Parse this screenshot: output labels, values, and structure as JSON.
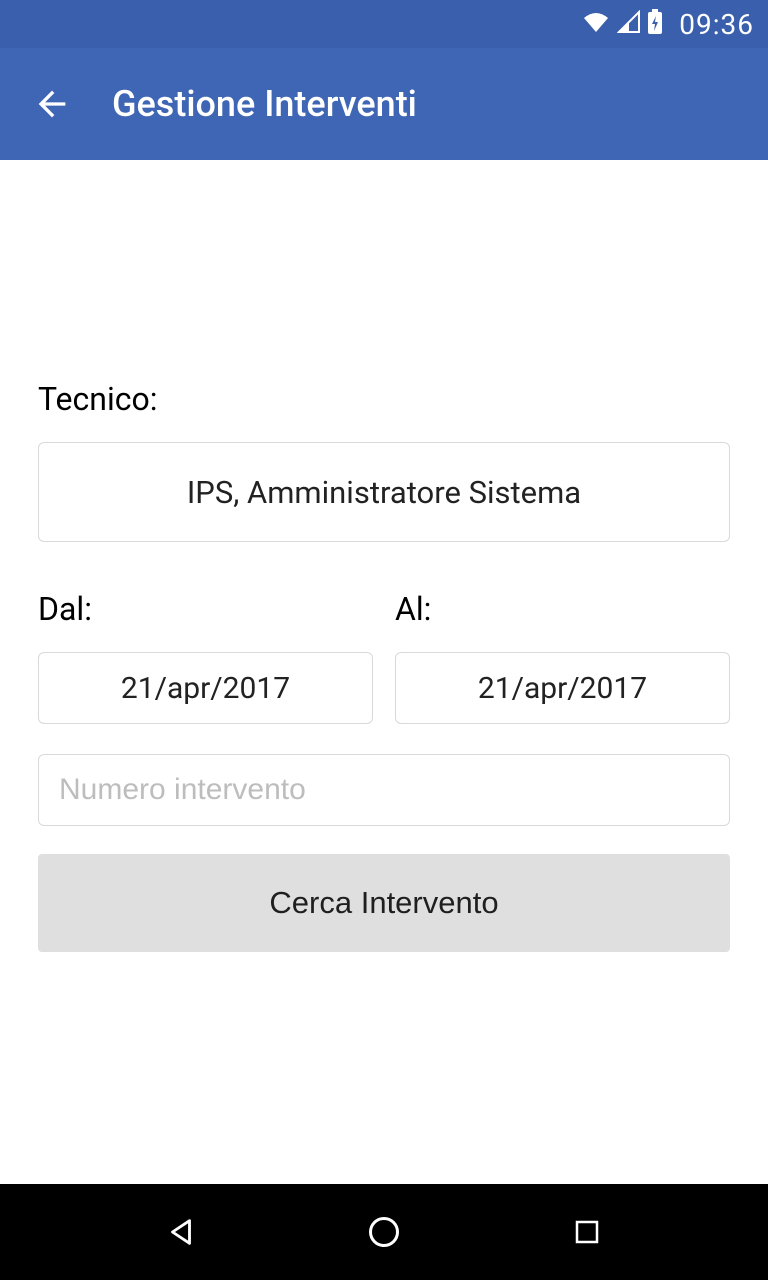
{
  "status": {
    "time": "09:36"
  },
  "appbar": {
    "title": "Gestione Interventi"
  },
  "form": {
    "tecnico_label": "Tecnico:",
    "tecnico_value": "IPS, Amministratore Sistema",
    "dal_label": "Dal:",
    "dal_value": "21/apr/2017",
    "al_label": "Al:",
    "al_value": "21/apr/2017",
    "numero_placeholder": "Numero intervento",
    "numero_value": "",
    "search_label": "Cerca Intervento"
  }
}
